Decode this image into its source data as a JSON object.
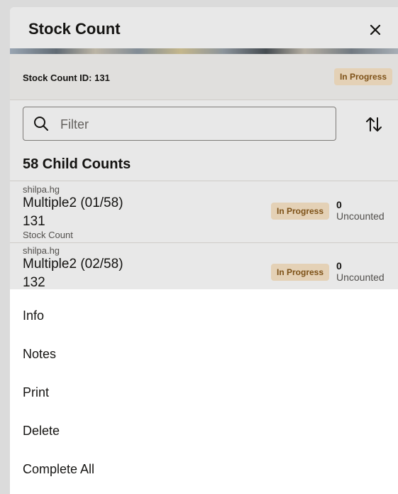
{
  "header": {
    "title": "Stock Count",
    "close_icon": "close-icon"
  },
  "summary": {
    "id_label": "Stock Count ID: 131",
    "status": "In Progress"
  },
  "filter": {
    "placeholder": "Filter",
    "value": ""
  },
  "list": {
    "heading": "58 Child Counts",
    "rows": [
      {
        "user": "shilpa.hg",
        "name": "Multiple2 (01/58)",
        "number": "131",
        "type": "Stock Count",
        "status": "In Progress",
        "count": "0",
        "count_label": "Uncounted"
      },
      {
        "user": "shilpa.hg",
        "name": "Multiple2 (02/58)",
        "number": "132",
        "type": "",
        "status": "In Progress",
        "count": "0",
        "count_label": "Uncounted"
      }
    ]
  },
  "menu": {
    "items": [
      {
        "label": "Info"
      },
      {
        "label": "Notes"
      },
      {
        "label": "Print"
      },
      {
        "label": "Delete"
      },
      {
        "label": "Complete All"
      }
    ]
  },
  "colors": {
    "badge_bg": "#fbe6c8",
    "badge_text": "#8a5a1a",
    "scrim": "#000000"
  }
}
